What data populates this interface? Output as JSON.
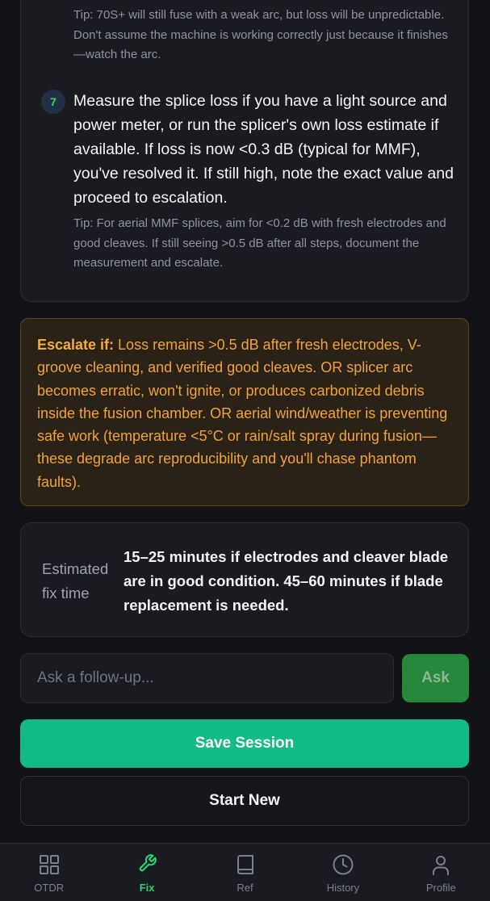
{
  "steps_card": {
    "tip_prev": "Tip: 70S+ will still fuse with a weak arc, but loss will be unpredictable. Don't assume the machine is working correctly just because it finishes—watch the arc.",
    "step_number": "7",
    "step_text": "Measure the splice loss if you have a light source and power meter, or run the splicer's own loss estimate if available. If loss is now <0.3 dB (typical for MMF), you've resolved it. If still high, note the exact value and proceed to escalation.",
    "step_tip": "Tip: For aerial MMF splices, aim for <0.2 dB with fresh electrodes and good cleaves. If still seeing >0.5 dB after all steps, document the measurement and escalate."
  },
  "escalation": {
    "label": "Escalate if:",
    "text": " Loss remains >0.5 dB after fresh electrodes, V-groove cleaning, and verified good cleaves. OR splicer arc becomes erratic, won't ignite, or produces carbonized debris inside the fusion chamber. OR aerial wind/weather is preventing safe work (temperature <5°C or rain/salt spray during fusion—these degrade arc reproducibility and you'll chase phantom faults)."
  },
  "estimate": {
    "label": "Estimated fix time",
    "value": "15–25 minutes if electrodes and cleaver blade are in good condition. 45–60 minutes if blade replacement is needed."
  },
  "followup": {
    "placeholder": "Ask a follow-up...",
    "ask_label": "Ask"
  },
  "actions": {
    "save_label": "Save Session",
    "new_label": "Start New"
  },
  "nav": {
    "items": [
      {
        "label": "OTDR",
        "icon": "grid-icon"
      },
      {
        "label": "Fix",
        "icon": "wrench-icon",
        "active": true
      },
      {
        "label": "Ref",
        "icon": "book-icon"
      },
      {
        "label": "History",
        "icon": "clock-icon"
      },
      {
        "label": "Profile",
        "icon": "user-icon"
      }
    ]
  },
  "colors": {
    "accent": "#27d46e",
    "warning": "#f0a33a",
    "save": "#12bb85"
  }
}
